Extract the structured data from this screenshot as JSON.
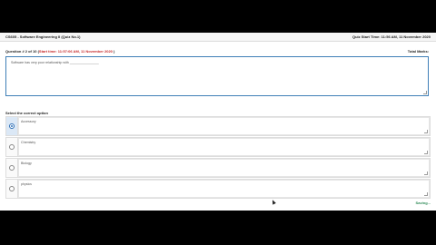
{
  "header": {
    "course": "CS605 - Software Engineering II (Quiz No.1)",
    "exam_start": "Quiz Start Time: 11:56 AM, 11 November 2020"
  },
  "question": {
    "number_label": "Question # 2 of 10 (",
    "start_time": "Start time: 11:57:06 AM, 11 November 2020",
    "close_paren": " )",
    "total_marks": "Total Marks:",
    "text": "Software has very poor relationship with ________________"
  },
  "options_heading": "Select the correct option",
  "options": [
    {
      "label": "Accessory",
      "selected": true
    },
    {
      "label": "Chemistry",
      "selected": false
    },
    {
      "label": "Biology",
      "selected": false
    },
    {
      "label": "physics",
      "selected": false
    }
  ],
  "status": "Saving..."
}
